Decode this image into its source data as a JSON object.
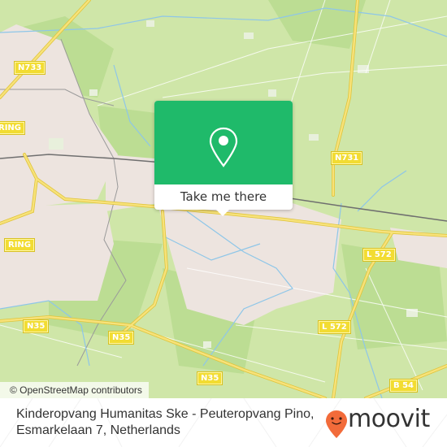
{
  "map": {
    "colors": {
      "farmland": "#cfe6a8",
      "forest": "#b8dc8c",
      "urban": "#ede4df",
      "road_major": "#f2d64a",
      "water": "#8ec6e8",
      "rail": "#777777",
      "popup_green": "#1fba6a"
    },
    "road_labels": [
      {
        "id": "n733",
        "text": "N733"
      },
      {
        "id": "ring-top",
        "text": "RING"
      },
      {
        "id": "ring-bottom",
        "text": "RING"
      },
      {
        "id": "n731",
        "text": "N731"
      },
      {
        "id": "l572-top",
        "text": "L 572"
      },
      {
        "id": "l572-bottom",
        "text": "L 572"
      },
      {
        "id": "n35-left",
        "text": "N35"
      },
      {
        "id": "n35-mid",
        "text": "N35"
      },
      {
        "id": "n35-bottom",
        "text": "N35"
      },
      {
        "id": "b54",
        "text": "B 54"
      }
    ]
  },
  "popup": {
    "icon": "map-pin-icon",
    "button_label": "Take me there"
  },
  "attribution": "© OpenStreetMap contributors",
  "footer": {
    "address_line1": "Kinderopvang Humanitas Ske - Peuteropvang Pino,",
    "address_line2": "Esmarkelaan 7, Netherlands",
    "brand_name": "moovit",
    "brand_icon": "moovit-logo-icon",
    "brand_color": "#f26b3a"
  }
}
